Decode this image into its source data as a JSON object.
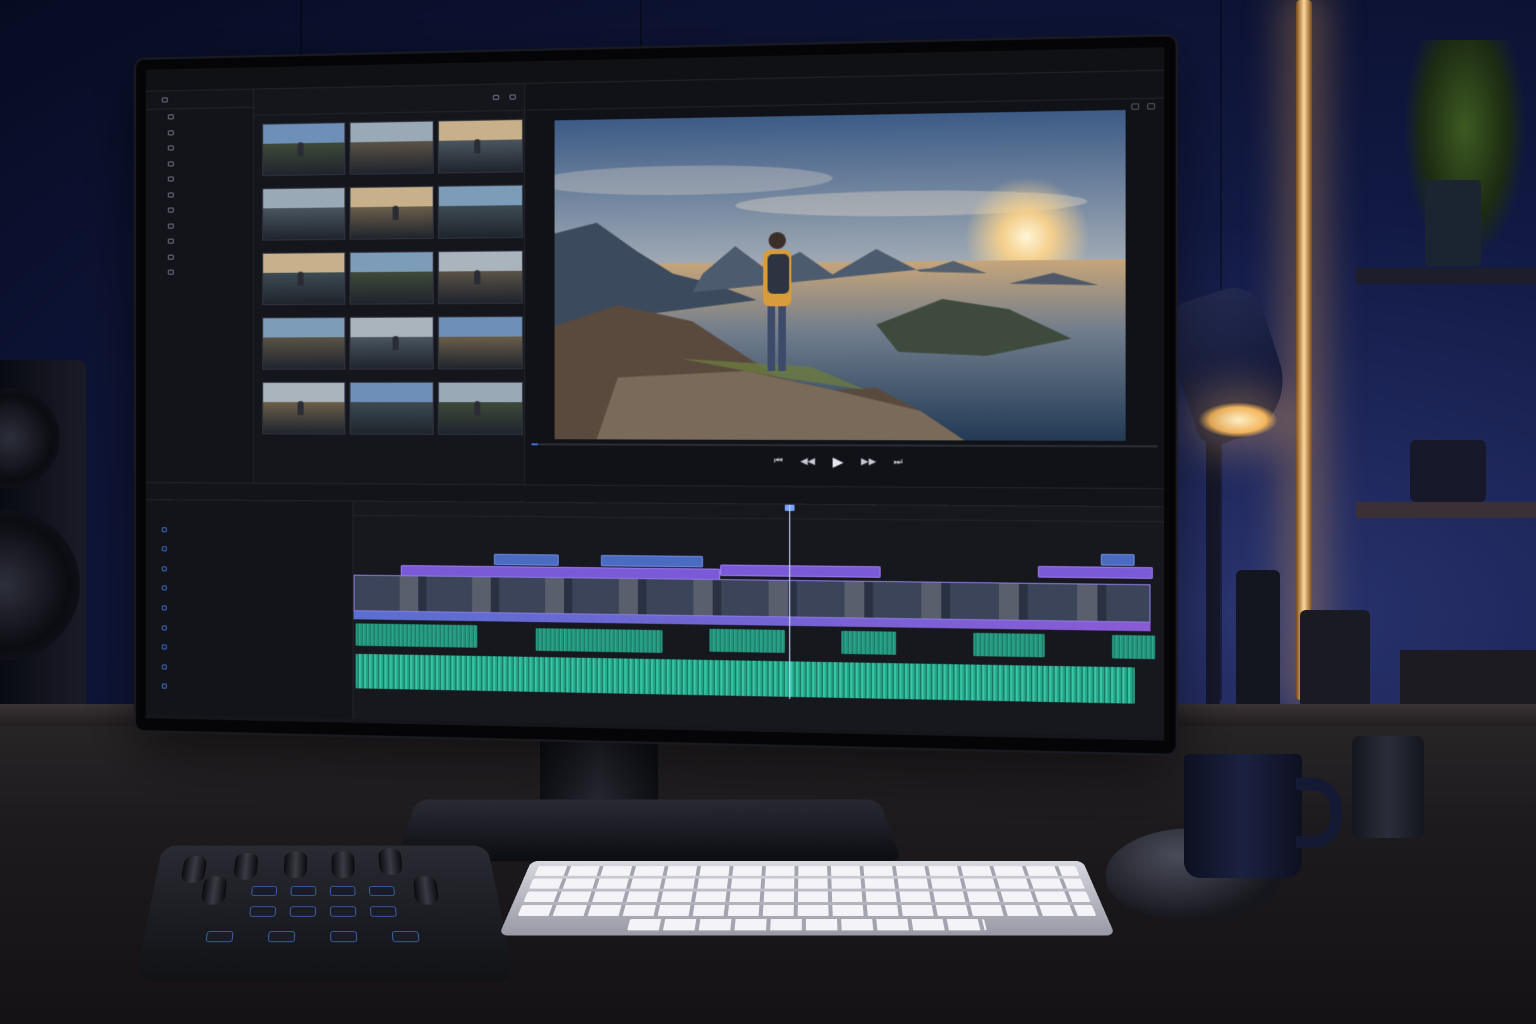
{
  "app": {
    "menu": [
      "",
      "",
      "",
      "",
      "",
      ""
    ],
    "sidebar_title": "",
    "sidebar_items": [
      "",
      "",
      "",
      "",
      "",
      "",
      "",
      "",
      "",
      "",
      ""
    ],
    "media_count": "",
    "viewer_tabs": [
      "",
      ""
    ],
    "timeline_toolbar": [
      "",
      "",
      "",
      ""
    ],
    "timeline_title": "",
    "ruler_ticks": [
      "",
      "",
      "",
      "",
      "",
      "",
      "",
      "",
      "",
      "",
      "",
      "",
      ""
    ],
    "tracks": [
      {
        "name": "",
        "type": "video"
      },
      {
        "name": "",
        "type": "video"
      },
      {
        "name": "",
        "type": "video"
      },
      {
        "name": "",
        "type": "video"
      },
      {
        "name": "",
        "type": "audio"
      },
      {
        "name": "",
        "type": "audio"
      },
      {
        "name": "",
        "type": "audio"
      },
      {
        "name": "",
        "type": "audio"
      },
      {
        "name": "",
        "type": "audio"
      }
    ],
    "playback_progress": 0.01,
    "playhead_fraction": 0.55,
    "transport": {
      "prev_label": "⏮",
      "rewind_label": "◀◀",
      "play_label": "▶",
      "forward_label": "▶▶",
      "next_label": "⏭"
    }
  },
  "colors": {
    "accent": "#3b6fd1",
    "clip_blue": "#4a6bbf",
    "clip_purple": "#7a5ad6",
    "audio_green": "#27a58a",
    "lamp_light": "#f4b55c"
  },
  "icons": {
    "play": "play-icon",
    "rewind": "rewind-icon",
    "forward": "forward-icon",
    "folder": "folder-icon"
  }
}
